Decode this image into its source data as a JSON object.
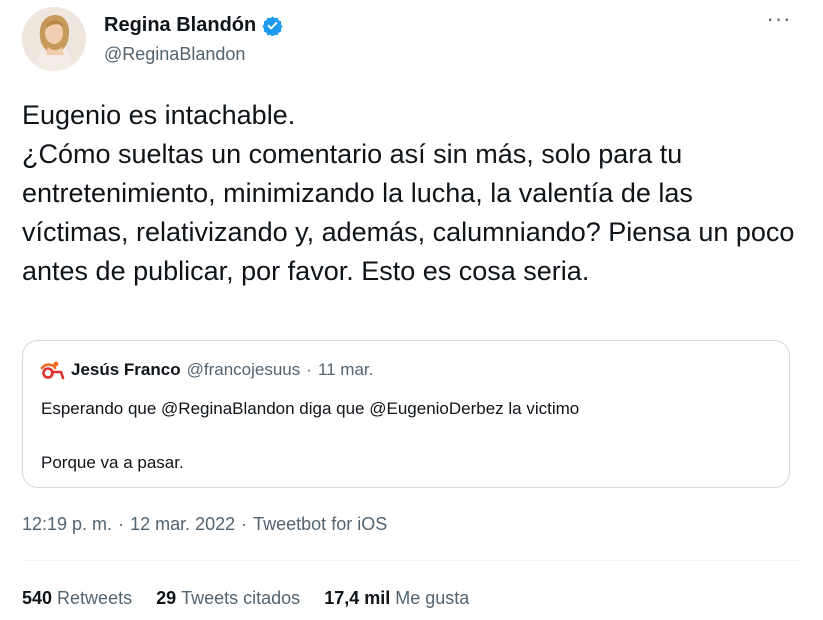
{
  "author": {
    "display_name": "Regina Blandón",
    "handle": "@ReginaBlandon",
    "avatar_icon": "profile-photo",
    "verified_icon": "verified-badge-icon"
  },
  "tweet": {
    "text": "Eugenio es intachable.\n¿Cómo sueltas un comentario así sin más, solo para tu entretenimiento, minimizando la lucha, la valentía de las víctimas, relativizando y, además, calumniando? Piensa un poco antes de publicar, por favor. Esto es cosa seria.",
    "more_icon": "more-options-icon"
  },
  "quoted": {
    "name": "Jesús Franco",
    "handle": "@francojesuus",
    "separator": "·",
    "date": "11 mar.",
    "line1": "Esperando que @ReginaBlandon diga que @EugenioDerbez la victimo",
    "line2": "Porque va a pasar.",
    "avatar_icon": "quoted-avatar-icon"
  },
  "meta": {
    "time": "12:19 p. m.",
    "sep1": "·",
    "date": "12 mar. 2022",
    "sep2": "·",
    "source": "Tweetbot for iOS"
  },
  "stats": {
    "retweets_count": "540",
    "retweets_label": "Retweets",
    "quotes_count": "29",
    "quotes_label": "Tweets citados",
    "likes_count": "17,4 mil",
    "likes_label": "Me gusta"
  },
  "colors": {
    "text": "#0f1419",
    "secondary": "#536471",
    "verified": "#1d9bf0",
    "border": "#cfd9de"
  }
}
